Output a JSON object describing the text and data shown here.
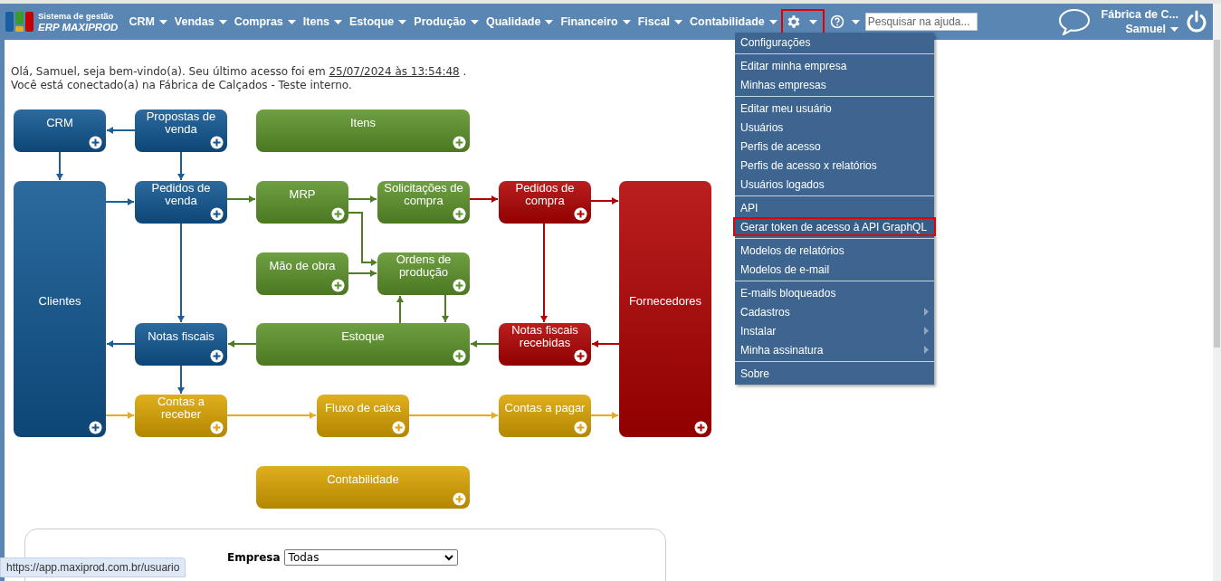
{
  "header": {
    "logo_line1": "Sistema de gestão",
    "logo_line2": "ERP MAXIPROD",
    "nav": [
      {
        "label": "CRM"
      },
      {
        "label": "Vendas"
      },
      {
        "label": "Compras"
      },
      {
        "label": "Itens"
      },
      {
        "label": "Estoque"
      },
      {
        "label": "Produção"
      },
      {
        "label": "Qualidade"
      },
      {
        "label": "Financeiro"
      },
      {
        "label": "Fiscal"
      },
      {
        "label": "Contabilidade"
      }
    ],
    "settings_selected": true,
    "help_search": {
      "placeholder": "Pesquisar na ajuda..."
    },
    "company": "Fábrica de C...",
    "user": "Samuel"
  },
  "welcome": {
    "line1_prefix": "Olá, Samuel, seja bem-vindo(a). Seu último acesso foi em",
    "last_access": "25/07/2024 às 13:54:48",
    "line1_suffix": ".",
    "line2": "Você está conectado(a) na Fábrica de Calçados - Teste interno."
  },
  "diagram": {
    "nodes": [
      {
        "label": "CRM",
        "color": "#0f5590"
      },
      {
        "label": "Propostas de venda",
        "color": "#0f5590"
      },
      {
        "label": "Itens",
        "color": "#5b9228"
      },
      {
        "label": "Clientes",
        "color": "#0f5590"
      },
      {
        "label": "Pedidos de venda",
        "color": "#0f5590"
      },
      {
        "label": "MRP",
        "color": "#5b9228"
      },
      {
        "label": "Solicitações de compra",
        "color": "#5b9228"
      },
      {
        "label": "Pedidos de compra",
        "color": "#b00000"
      },
      {
        "label": "Fornecedores",
        "color": "#b00000"
      },
      {
        "label": "Mão de obra",
        "color": "#5b9228"
      },
      {
        "label": "Ordens de produção",
        "color": "#5b9228"
      },
      {
        "label": "Notas fiscais",
        "color": "#0f5590"
      },
      {
        "label": "Estoque",
        "color": "#5b9228"
      },
      {
        "label": "Notas fiscais recebidas",
        "color": "#b00000"
      },
      {
        "label": "Contas a receber",
        "color": "#dba400"
      },
      {
        "label": "Fluxo de caixa",
        "color": "#dba400"
      },
      {
        "label": "Contas a pagar",
        "color": "#dba400"
      },
      {
        "label": "Contabilidade",
        "color": "#dba400"
      }
    ]
  },
  "settings_menu": {
    "groups": [
      [
        {
          "label": "Configurações",
          "submenu": false,
          "selected": false
        }
      ],
      [
        {
          "label": "Editar minha empresa",
          "submenu": false,
          "selected": false
        },
        {
          "label": "Minhas empresas",
          "submenu": false,
          "selected": false
        }
      ],
      [
        {
          "label": "Editar meu usuário",
          "submenu": false,
          "selected": false
        },
        {
          "label": "Usuários",
          "submenu": false,
          "selected": false
        },
        {
          "label": "Perfis de acesso",
          "submenu": false,
          "selected": false
        },
        {
          "label": "Perfis de acesso x relatórios",
          "submenu": false,
          "selected": false
        },
        {
          "label": "Usuários logados",
          "submenu": false,
          "selected": false
        }
      ],
      [
        {
          "label": "API",
          "submenu": false,
          "selected": false
        },
        {
          "label": "Gerar token de acesso à API GraphQL",
          "submenu": false,
          "selected": true
        }
      ],
      [
        {
          "label": "Modelos de relatórios",
          "submenu": false,
          "selected": false
        },
        {
          "label": "Modelos de e-mail",
          "submenu": false,
          "selected": false
        }
      ],
      [
        {
          "label": "E-mails bloqueados",
          "submenu": false,
          "selected": false
        },
        {
          "label": "Cadastros",
          "submenu": true,
          "selected": false
        },
        {
          "label": "Instalar",
          "submenu": true,
          "selected": false
        },
        {
          "label": "Minha assinatura",
          "submenu": true,
          "selected": false
        }
      ],
      [
        {
          "label": "Sobre",
          "submenu": false,
          "selected": false
        }
      ]
    ]
  },
  "filter": {
    "company_label": "Empresa",
    "company_value": "Todas"
  },
  "status_url": "https://app.maxiprod.com.br/usuario"
}
